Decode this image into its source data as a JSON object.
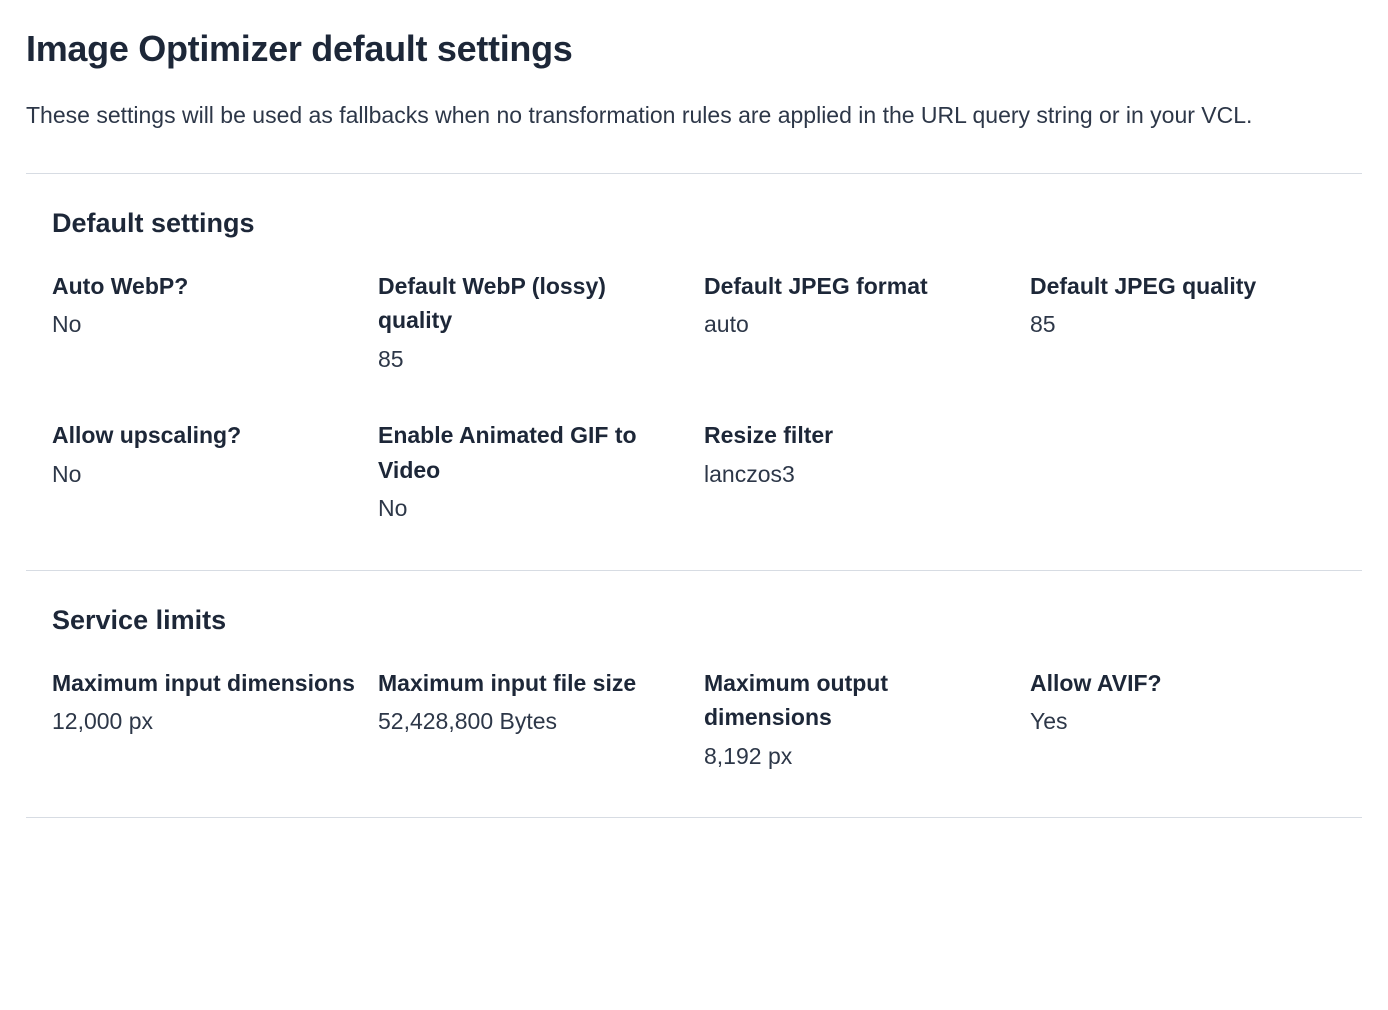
{
  "header": {
    "title": "Image Optimizer default settings",
    "description": "These settings will be used as fallbacks when no transformation rules are applied in the URL query string or in your VCL."
  },
  "sections": {
    "default_settings": {
      "title": "Default settings",
      "items": [
        {
          "label": "Auto WebP?",
          "value": "No"
        },
        {
          "label": "Default WebP (lossy) quality",
          "value": "85"
        },
        {
          "label": "Default JPEG format",
          "value": "auto"
        },
        {
          "label": "Default JPEG quality",
          "value": "85"
        },
        {
          "label": "Allow upscaling?",
          "value": "No"
        },
        {
          "label": "Enable Animated GIF to Video",
          "value": "No"
        },
        {
          "label": "Resize filter",
          "value": "lanczos3"
        }
      ]
    },
    "service_limits": {
      "title": "Service limits",
      "items": [
        {
          "label": "Maximum input dimensions",
          "value": "12,000 px"
        },
        {
          "label": "Maximum input file size",
          "value": "52,428,800 Bytes"
        },
        {
          "label": "Maximum output dimensions",
          "value": "8,192 px"
        },
        {
          "label": "Allow AVIF?",
          "value": "Yes"
        }
      ]
    }
  }
}
